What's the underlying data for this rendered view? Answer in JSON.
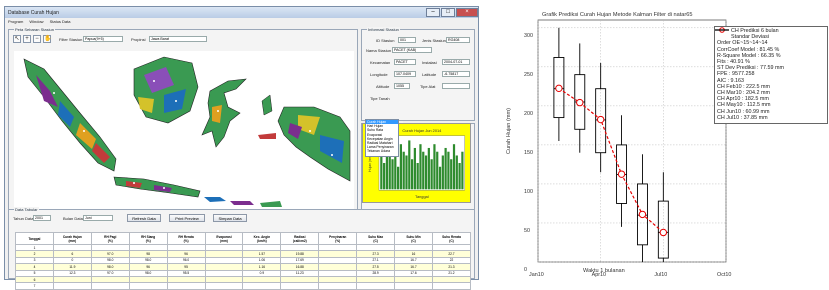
{
  "app": {
    "title": "Database Curah Hujan",
    "menu": [
      "Program",
      "Window",
      "Status Data"
    ]
  },
  "map_panel": {
    "title": "Peta Sebaran Stasiun",
    "tools": [
      "cursor-icon",
      "zoom-in-icon",
      "zoom-out-icon",
      "pan-icon"
    ],
    "filter_label": "Filter Stasiun",
    "filter_value": "Papua(9+5)",
    "province_label": "Propinsi",
    "province_value": "Jawa Barat"
  },
  "station_info": {
    "title": "Informasi Stasiun",
    "id_label": "ID Stasiun",
    "id_value": "001",
    "wmo_label": "Jenis Stasiun",
    "wmo_value": "RG408",
    "name_label": "Nama Stasiun",
    "name_value": "PACET (KAB)",
    "kec_label": "Kecamatan",
    "kec_value": "PACET",
    "dist_label": "Instalasi",
    "dist_value": "2004-07-01",
    "lon_label": "Longitude",
    "lon_value": "107.0409",
    "lat_label": "Latitude",
    "lat_value": "-6.75817",
    "alt_label": "Altitude",
    "alt_value": "1055",
    "type_label": "Tipe Alat",
    "type_value": "",
    "note_label": "Tipe Tanah"
  },
  "grafik": {
    "title": "Grafik Data Tabular",
    "data_label": "Data",
    "data_value": "Curah Hujan",
    "refresh_label": "Refresh Grafik",
    "options": [
      "Curah Hujan",
      "Hari Hujan",
      "Suhu Rata",
      "Evaporasi",
      "Kecepatan Angin",
      "Radiasi Matahari",
      "Lama Penyinaran",
      "Tekanan Udara"
    ],
    "selected_index": 0,
    "mini_title": "Curah Hujan Jun 2014",
    "mini_ylabel": "Hujan (mm)",
    "mini_xlabel": "Tanggal",
    "mini_values": [
      9,
      7,
      10,
      12,
      8,
      11,
      6,
      12,
      10,
      9,
      13,
      8,
      11,
      7,
      12,
      10,
      9,
      11,
      8,
      12,
      10,
      6,
      9,
      11,
      10,
      8,
      12,
      9,
      7,
      10
    ]
  },
  "data_tabel": {
    "title": "Data Tabular",
    "year_label": "Tahun Data",
    "year_value": "2001",
    "month_label": "Bulan Data",
    "month_value": "Juni",
    "refresh_label": "Refresh Data",
    "print_label": "Print Preview",
    "save_label": "Simpan Data",
    "columns": [
      [
        "Tanggal",
        ""
      ],
      [
        "Curah Hujan",
        "(mm)"
      ],
      [
        "RH Pagi",
        "(%)"
      ],
      [
        "RH Siang",
        "(%)"
      ],
      [
        "RH Rerata",
        "(%)"
      ],
      [
        "Evaporasi",
        "(mm)"
      ],
      [
        "Kec. Angin",
        "(km/h)"
      ],
      [
        "Radiasi",
        "(cal/cm2)"
      ],
      [
        "Penyinaran",
        "(%)"
      ],
      [
        "Suhu Max",
        "(C)"
      ],
      [
        "Suhu Min",
        "(C)"
      ],
      [
        "Suhu Rerata",
        "(C)"
      ]
    ],
    "rows": [
      [
        "1",
        "",
        "",
        "",
        "",
        "",
        "",
        "",
        "",
        "",
        "",
        ""
      ],
      [
        "2",
        "6",
        "97.0",
        "98",
        "96",
        "",
        "1.57",
        "19.88",
        "",
        "27.3",
        "16",
        "22.7"
      ],
      [
        "3",
        "0",
        "98.0",
        "98.0",
        "96.0",
        "",
        "1.06",
        "17.69",
        "",
        "27.1",
        "16.7",
        "22"
      ],
      [
        "4",
        "11.9",
        "98.0",
        "96",
        "95",
        "",
        "1.16",
        "16.88",
        "",
        "27.5",
        "16.7",
        "21.3"
      ],
      [
        "5",
        "12.3",
        "97.0",
        "98.0",
        "95.5",
        "",
        "0.9",
        "11.23",
        "",
        "28.9",
        "17.6",
        "21.2"
      ],
      [
        "6",
        "",
        "",
        "",
        "",
        "",
        "",
        "",
        "",
        "",
        "",
        ""
      ],
      [
        "7",
        "",
        "",
        "",
        "",
        "",
        "",
        "",
        "",
        "",
        "",
        ""
      ]
    ]
  },
  "chart_data": {
    "type": "box",
    "title": "Grafik Prediksi Curah Hujan Metode Kalman Filter di natar65",
    "xlabel": "Waktu 1 bulanan",
    "ylabel": "Curah Hujan (mm)",
    "xticks": [
      "Jan10",
      "Apr10",
      "Jul10",
      "Oct10"
    ],
    "yticks": [
      0,
      50,
      100,
      150,
      200,
      250,
      300
    ],
    "ylim": [
      0,
      310
    ],
    "grid": true,
    "legend_position": "top-right",
    "x": [
      "Feb10",
      "Mar10",
      "Apr10",
      "May10",
      "Jun10",
      "Jul10"
    ],
    "series": [
      {
        "name": "CH Prediksi 6 bulan",
        "values": [
          222.5,
          204.2,
          182.5,
          112.5,
          60.99,
          37.85
        ]
      }
    ],
    "boxes": [
      {
        "whisker_low": 155,
        "q1": 185,
        "median": 222,
        "q3": 262,
        "whisker_high": 300
      },
      {
        "whisker_low": 140,
        "q1": 170,
        "median": 205,
        "q3": 240,
        "whisker_high": 280
      },
      {
        "whisker_low": 115,
        "q1": 140,
        "median": 182,
        "q3": 222,
        "whisker_high": 255
      },
      {
        "whisker_low": 45,
        "q1": 75,
        "median": 112,
        "q3": 150,
        "whisker_high": 188
      },
      {
        "whisker_low": 0,
        "q1": 22,
        "median": 60,
        "q3": 100,
        "whisker_high": 138
      },
      {
        "whisker_low": 0,
        "q1": 5,
        "median": 38,
        "q3": 78,
        "whisker_high": 115
      }
    ],
    "legend": [
      "CH Prediksi 6 bulan",
      "Standar Deviasi",
      "Order OE~15~14~14",
      "CorrCoef Model : 81.45 %",
      "R-Square Model : 66.35 %",
      "Fits : 40.91 %",
      "ST Dev Prediksi : 77.59 mm",
      "FPE : 9577.258",
      "AIC : 9.163",
      "CH Feb10 : 222.5 mm",
      "CH Mar10 : 204.2 mm",
      "CH Apr10 : 182.5 mm",
      "CH May10 : 112.5 mm",
      "CH Jun10 : 60.99 mm",
      "CH Jul10 : 37.85 mm"
    ],
    "colors": {
      "prediction": "#e60000",
      "box": "#000000"
    }
  }
}
